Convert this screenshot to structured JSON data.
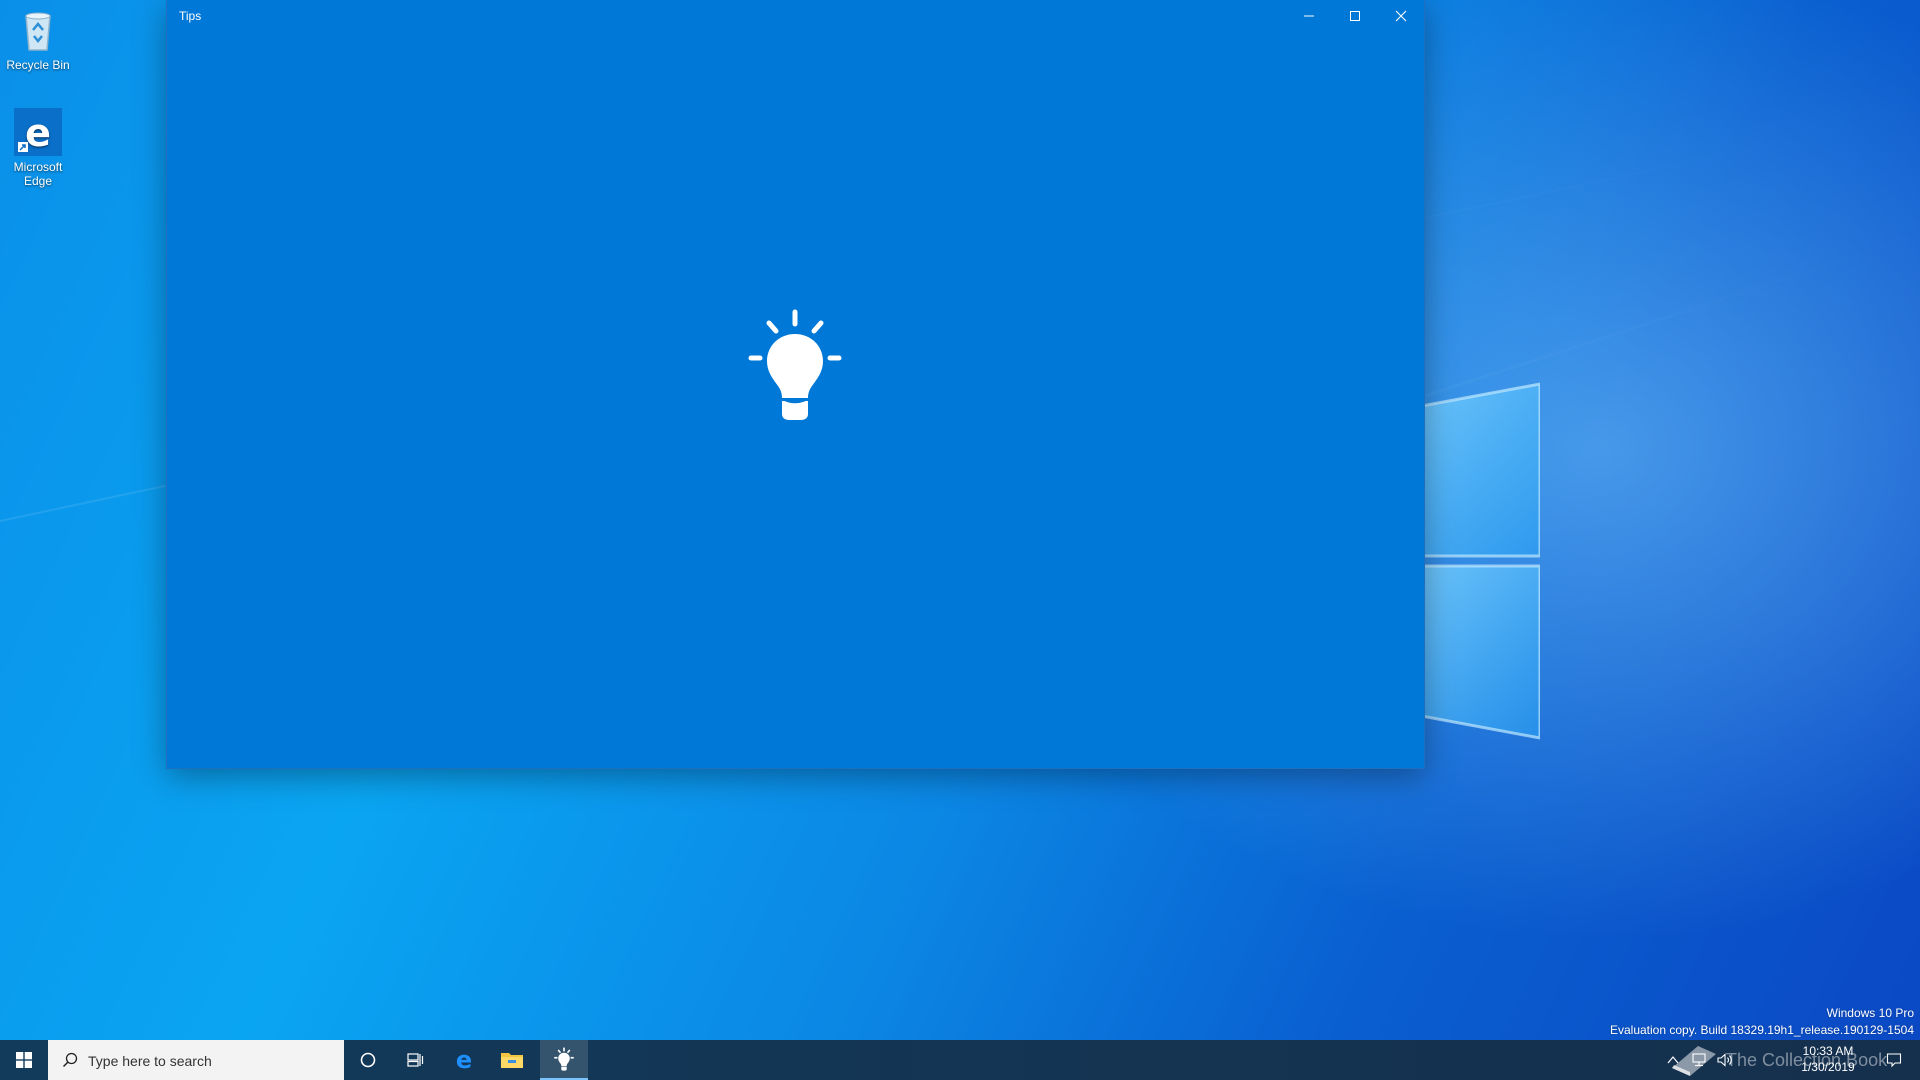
{
  "desktop": {
    "icons": [
      {
        "label": "Recycle Bin",
        "icon": "recycle-bin-icon"
      },
      {
        "label": "Microsoft\nEdge",
        "icon": "edge-icon"
      }
    ],
    "watermark": {
      "edition": "Windows 10 Pro",
      "build": "Evaluation copy. Build 18329.19h1_release.190129-1504"
    },
    "overlay_logo_text": "The Collection Book"
  },
  "window": {
    "title": "Tips",
    "background": "#0078d7",
    "splash_icon": "lightbulb-icon",
    "controls": {
      "minimize": "minimize-icon",
      "maximize": "maximize-icon",
      "close": "close-icon"
    }
  },
  "taskbar": {
    "search_placeholder": "Type here to search",
    "pinned": [
      {
        "name": "cortana",
        "icon": "cortana-circle-icon"
      },
      {
        "name": "task-view",
        "icon": "task-view-icon"
      },
      {
        "name": "edge",
        "icon": "edge-icon"
      },
      {
        "name": "file-explorer",
        "icon": "folder-icon"
      },
      {
        "name": "tips",
        "icon": "lightbulb-icon",
        "active": true
      }
    ],
    "clock": {
      "time": "10:33 AM",
      "date": "1/30/2019"
    }
  }
}
